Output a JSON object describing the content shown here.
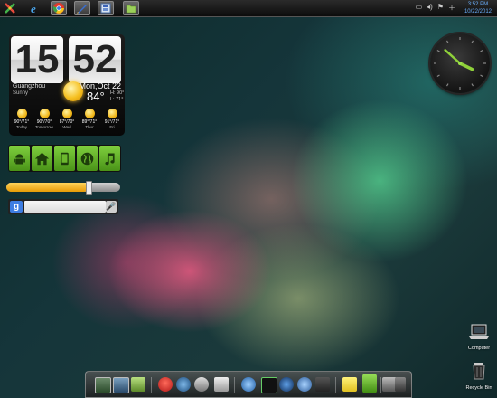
{
  "taskbar": {
    "apps": [
      {
        "name": "start-menu",
        "icon": "multicolor-x-icon"
      },
      {
        "name": "internet-explorer",
        "icon": "ie-icon"
      },
      {
        "name": "chrome",
        "icon": "chrome-icon"
      },
      {
        "name": "editor",
        "icon": "pen-tool-icon"
      },
      {
        "name": "monitor",
        "icon": "monitor-icon"
      },
      {
        "name": "folder",
        "icon": "folder-icon"
      }
    ],
    "tray_clock": {
      "time": "3:52 PM",
      "date": "10/22/2012"
    }
  },
  "weather_widget": {
    "hour": "15",
    "minute": "52",
    "city": "Guangzhou",
    "condition": "Sunny",
    "date": "Mon,Oct 22",
    "temperature": "84°",
    "high": "H: 90°",
    "low": "L: 71°",
    "forecast": [
      {
        "temps": "90°/71°",
        "day": "Today"
      },
      {
        "temps": "90°/70°",
        "day": "Tomorrow"
      },
      {
        "temps": "87°/70°",
        "day": "Wed"
      },
      {
        "temps": "89°/71°",
        "day": "Thur"
      },
      {
        "temps": "91°/71°",
        "day": "Fri"
      }
    ]
  },
  "shortcuts": [
    {
      "name": "android",
      "icon": "android-icon"
    },
    {
      "name": "home",
      "icon": "home-icon"
    },
    {
      "name": "phone",
      "icon": "phone-icon"
    },
    {
      "name": "globe",
      "icon": "globe-icon"
    },
    {
      "name": "music",
      "icon": "music-note-icon"
    }
  ],
  "brightness": {
    "level": 0.72
  },
  "search": {
    "logo": "g",
    "placeholder": ""
  },
  "analog_clock": {
    "hour": 3,
    "minute": 52
  },
  "desktop_icons": [
    {
      "label": "Computer",
      "icon": "laptop-icon"
    },
    {
      "label": "Recycle Bin",
      "icon": "recycle-bin-icon"
    }
  ],
  "colors": {
    "accent_green": "#5aa820",
    "slider_orange": "#f0a814",
    "tray_blue": "#6ab0ff"
  }
}
